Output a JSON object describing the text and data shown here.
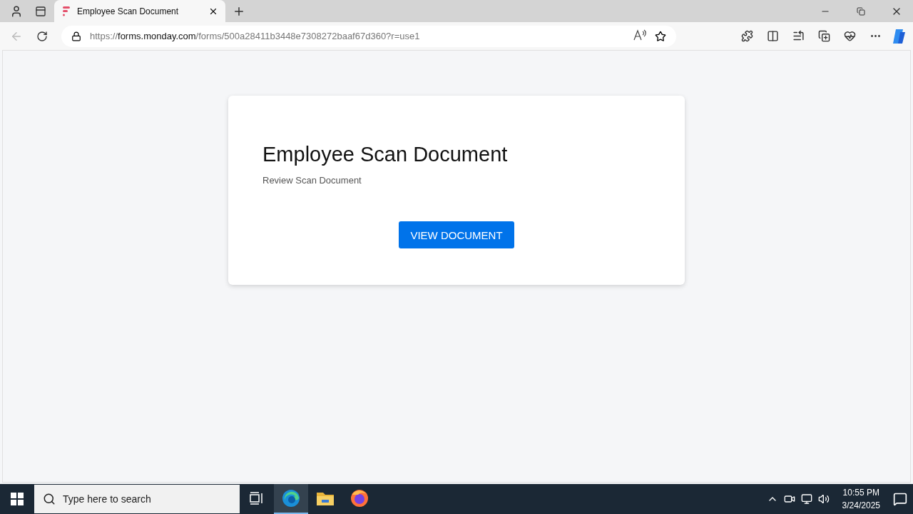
{
  "browser": {
    "tabs": [
      {
        "title": "Employee Scan Document",
        "selected": true
      }
    ],
    "address": "https://**forms.monday.com**/forms/500a28411b3448e7308272baaf67d360?r=use1"
  },
  "form": {
    "title": "Employee Scan Document",
    "subtitle": "Review Scan Document",
    "button": "VIEW DOCUMENT"
  },
  "taskbar": {
    "search_placeholder": "Type here to search",
    "apps": [
      {
        "kind": "taskview",
        "selected": false
      },
      {
        "kind": "edge",
        "selected": true
      },
      {
        "kind": "folder",
        "selected": false
      },
      {
        "kind": "firefox",
        "selected": false
      }
    ],
    "time": "10:55 PM",
    "date": "3/24/2025"
  }
}
